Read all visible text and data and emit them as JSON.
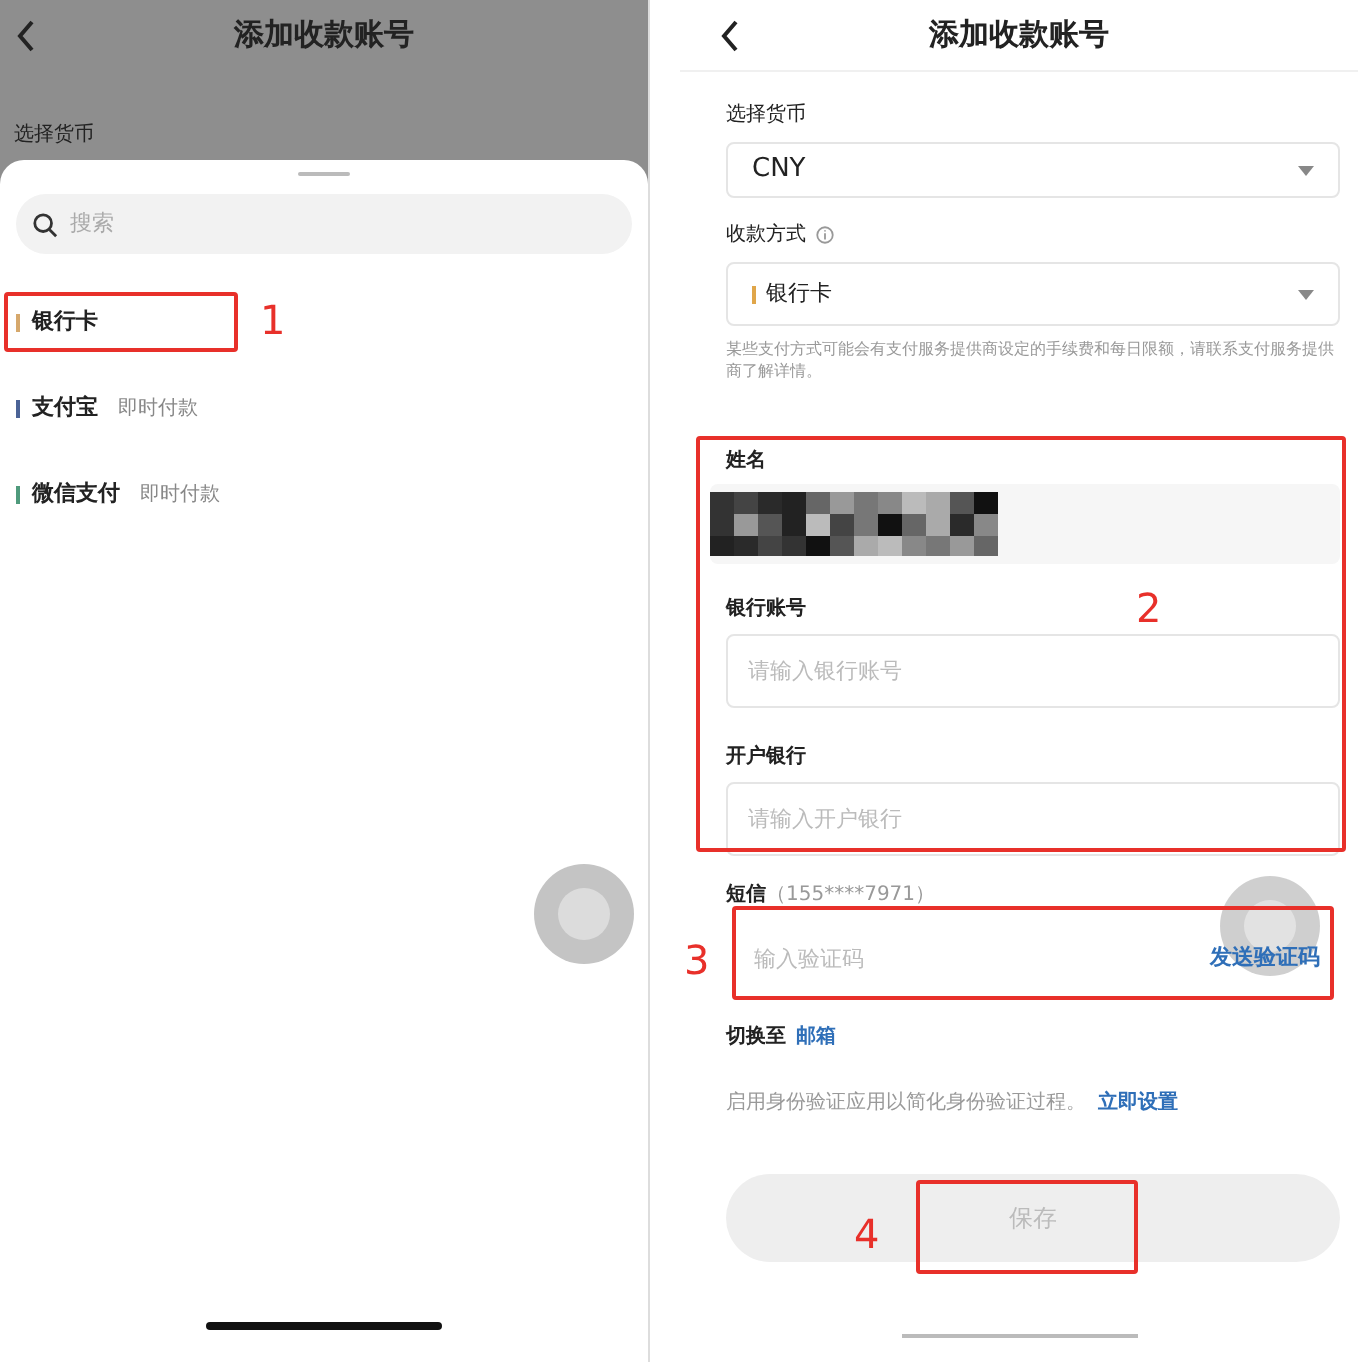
{
  "left_screen": {
    "title": "添加收款账号",
    "currency_label": "选择货币",
    "search": {
      "placeholder": "搜索"
    },
    "methods": [
      {
        "name": "银行卡",
        "color": "#d6a86c"
      },
      {
        "name": "支付宝",
        "tag": "即时付款",
        "color": "#4b6396"
      },
      {
        "name": "微信支付",
        "tag": "即时付款",
        "color": "#4f9a7c"
      }
    ]
  },
  "right_screen": {
    "title": "添加收款账号",
    "currency": {
      "label": "选择货币",
      "value": "CNY"
    },
    "method": {
      "label": "收款方式",
      "value": "银行卡",
      "color": "#e0a64a"
    },
    "note": "某些支付方式可能会有支付服务提供商设定的手续费和每日限额，请联系支付服务提供商了解详情。",
    "name_field": {
      "label": "姓名"
    },
    "account_field": {
      "label": "银行账号",
      "placeholder": "请输入银行账号"
    },
    "bank_field": {
      "label": "开户银行",
      "placeholder": "请输入开户银行"
    },
    "sms": {
      "label": "短信",
      "phone": "（155****7971）",
      "placeholder": "输入验证码",
      "action": "发送验证码"
    },
    "switch": {
      "label": "切换至",
      "link": "邮箱"
    },
    "tip": {
      "text": "启用身份验证应用以简化身份验证过程。",
      "link": "立即设置"
    },
    "save": {
      "label": "保存",
      "disabled": true
    }
  },
  "annotations": [
    {
      "label": "1"
    },
    {
      "label": "2"
    },
    {
      "label": "3"
    },
    {
      "label": "4"
    }
  ]
}
